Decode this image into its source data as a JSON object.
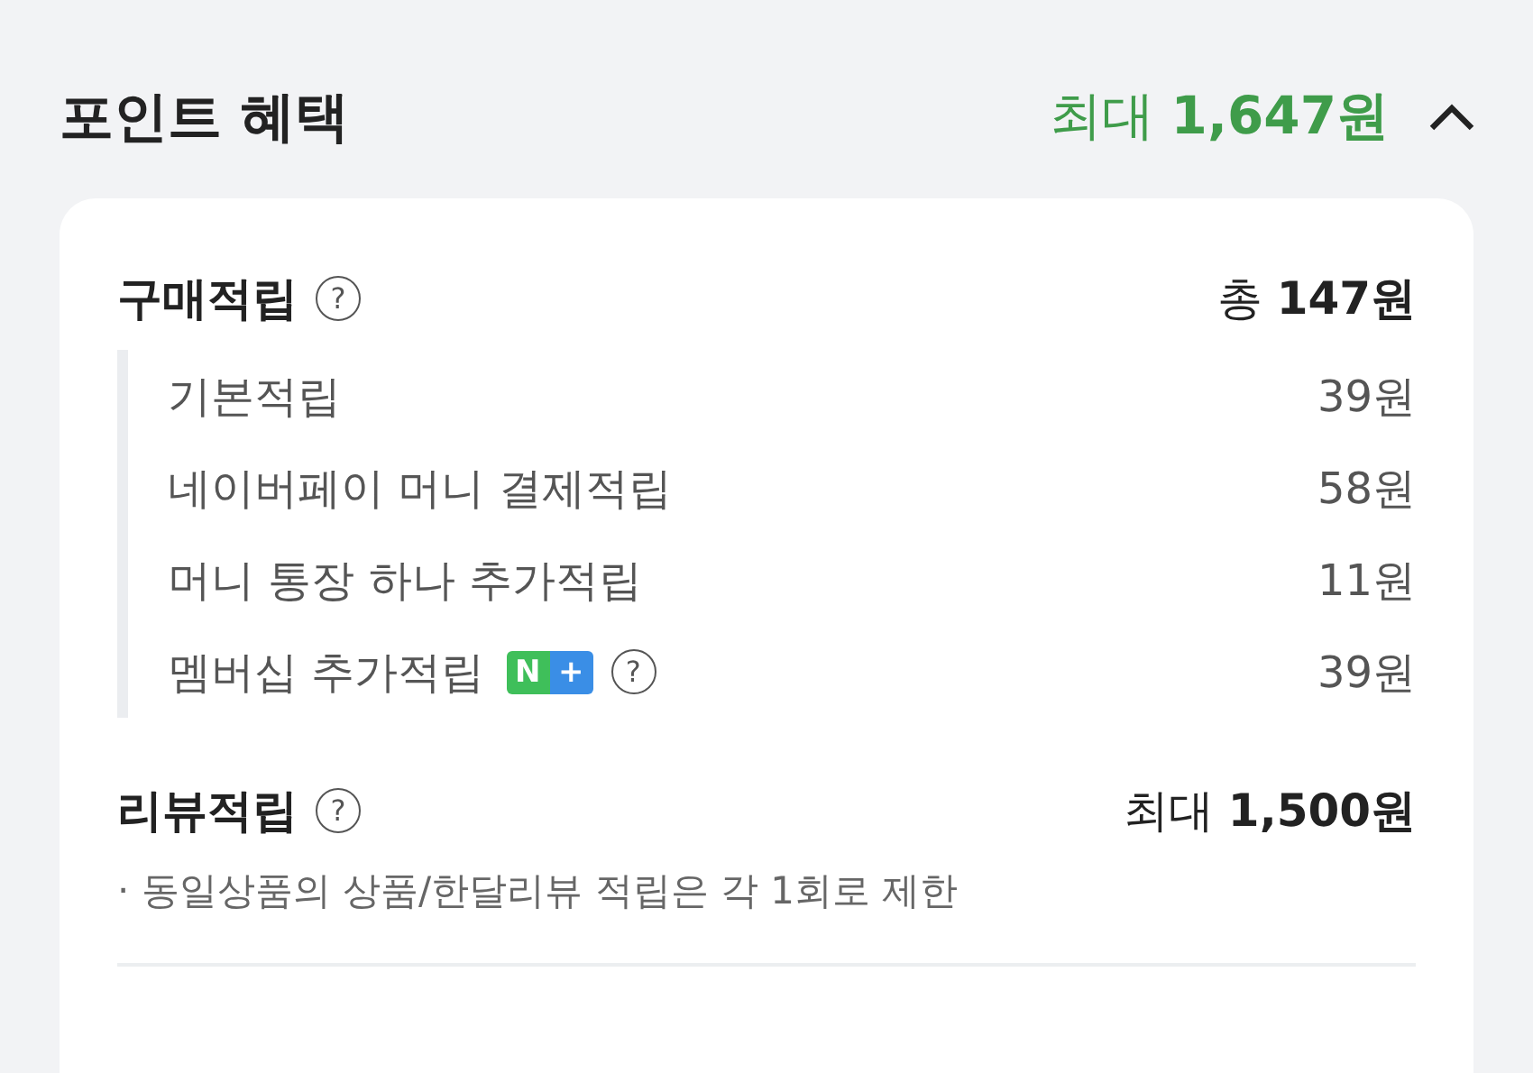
{
  "header": {
    "title": "포인트 혜택",
    "total": "최대 **1,647원**",
    "expanded": true
  },
  "sections": [
    {
      "title": "구매적립",
      "help": "?",
      "amount": "총 **147원**",
      "items": [
        {
          "label": "기본적립",
          "amount": "39원"
        },
        {
          "label": "네이버페이 머니 결제적립",
          "amount": "58원"
        },
        {
          "label": "머니 통장 하나 추가적립",
          "amount": "11원"
        },
        {
          "label": "멤버십 추가적립",
          "badge": [
            "N",
            "+"
          ],
          "help": "?",
          "amount": "39원"
        }
      ]
    },
    {
      "title": "리뷰적립",
      "help": "?",
      "amount": "최대 **1,500원**",
      "note": "· 동일상품의 상품/한달리뷰 적립은 각 1회로 제한"
    }
  ]
}
